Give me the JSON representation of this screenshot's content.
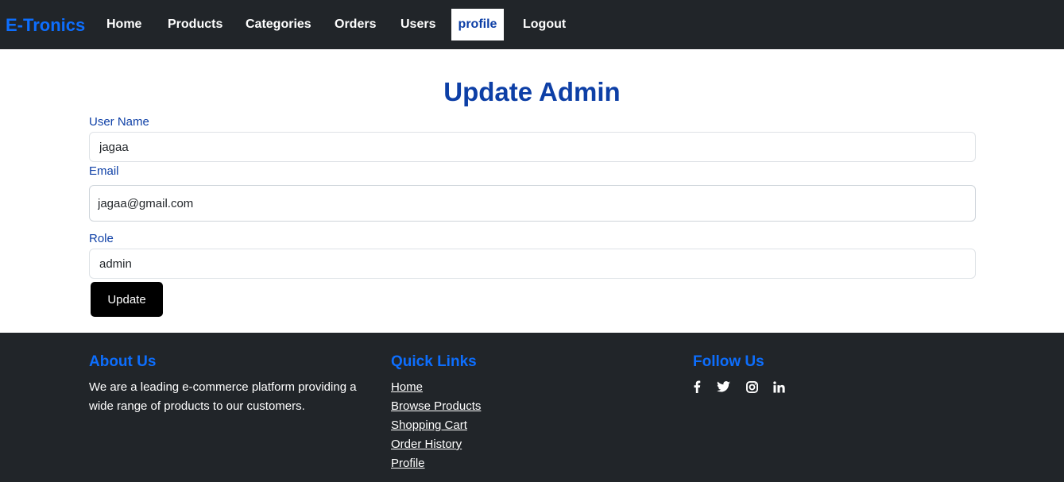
{
  "navbar": {
    "brand": "E-Tronics",
    "links": [
      {
        "label": "Home"
      },
      {
        "label": "Products"
      },
      {
        "label": "Categories"
      },
      {
        "label": "Orders"
      },
      {
        "label": "Users"
      },
      {
        "label": "profile",
        "active": true
      },
      {
        "label": "Logout"
      }
    ]
  },
  "form": {
    "title": "Update Admin",
    "username_label": "User Name",
    "username_value": "jagaa",
    "email_label": "Email",
    "email_value": "jagaa@gmail.com",
    "role_label": "Role",
    "role_value": "admin",
    "submit_label": "Update"
  },
  "footer": {
    "about": {
      "heading": "About Us",
      "text": "We are a leading e-commerce platform providing a wide range of products to our customers."
    },
    "quick_links": {
      "heading": "Quick Links",
      "items": [
        "Home",
        "Browse Products",
        "Shopping Cart",
        "Order History",
        "Profile"
      ]
    },
    "follow": {
      "heading": "Follow Us",
      "icons": [
        "facebook-icon",
        "twitter-icon",
        "instagram-icon",
        "linkedin-icon"
      ]
    }
  },
  "colors": {
    "navbar_bg": "#212529",
    "brand": "#0d6efd",
    "heading_blue": "#0d3fa6",
    "button_bg": "#000000"
  }
}
